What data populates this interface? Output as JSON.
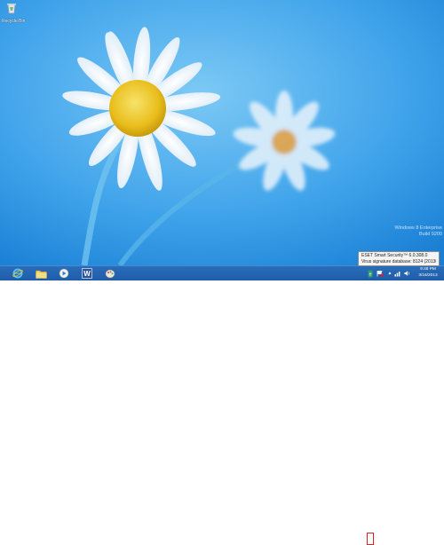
{
  "desktop": {
    "icons": [
      {
        "label": "Recycle Bin",
        "icon": "recycle-bin-icon"
      }
    ],
    "watermark": [
      "Windows 8 Enterprise",
      "Build 9200"
    ]
  },
  "tooltip": {
    "line1": "ESET Smart Security™ 6.0.308.0",
    "line2": "Virus signature database: 8124 (20130316)"
  },
  "taskbar": {
    "pinned": [
      {
        "name": "internet-explorer",
        "icon": "ie-icon"
      },
      {
        "name": "file-explorer",
        "icon": "folder-icon"
      },
      {
        "name": "media-player",
        "icon": "media-player-icon"
      },
      {
        "name": "word",
        "icon": "word-icon"
      },
      {
        "name": "paint",
        "icon": "paint-icon"
      }
    ],
    "tray": {
      "eset_icon": "eset-icon",
      "show_hidden": "▲",
      "flag_icon": "action-center-icon"
    },
    "clock": {
      "time": "9:48 PM",
      "date": "3/16/2013"
    }
  },
  "colors": {
    "sky_light": "#6ec0f2",
    "sky_dark": "#1f86d8",
    "taskbar": "#2466b2",
    "accent": "#e02020"
  }
}
